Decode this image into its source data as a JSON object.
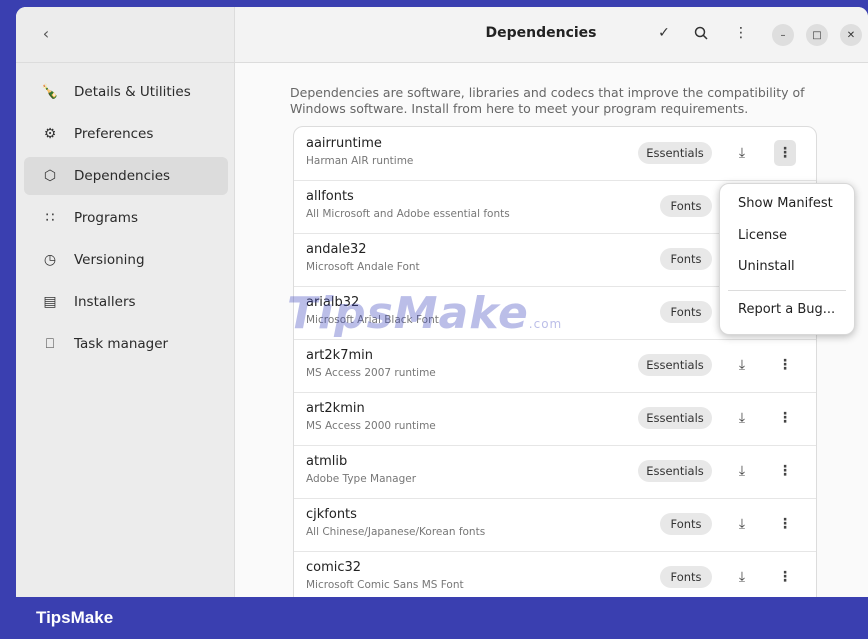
{
  "window": {
    "title": "Dependencies"
  },
  "sidebar": {
    "items": [
      {
        "label": "Details & Utilities",
        "icon": "bottle-icon"
      },
      {
        "label": "Preferences",
        "icon": "gear-icon"
      },
      {
        "label": "Dependencies",
        "icon": "puzzle-icon"
      },
      {
        "label": "Programs",
        "icon": "grid-icon"
      },
      {
        "label": "Versioning",
        "icon": "clock-icon"
      },
      {
        "label": "Installers",
        "icon": "package-icon"
      },
      {
        "label": "Task manager",
        "icon": "monitor-icon"
      }
    ]
  },
  "main": {
    "description": "Dependencies are software, libraries and codecs that improve the compatibility of Windows software. Install from here to meet your program requirements."
  },
  "dependencies": [
    {
      "name": "aairruntime",
      "desc": "Harman AIR runtime",
      "category": "Essentials"
    },
    {
      "name": "allfonts",
      "desc": "All Microsoft and Adobe essential fonts",
      "category": "Fonts"
    },
    {
      "name": "andale32",
      "desc": "Microsoft Andale Font",
      "category": "Fonts"
    },
    {
      "name": "arialb32",
      "desc": "Microsoft Arial Black Font",
      "category": "Fonts"
    },
    {
      "name": "art2k7min",
      "desc": "MS Access 2007 runtime",
      "category": "Essentials"
    },
    {
      "name": "art2kmin",
      "desc": "MS Access 2000 runtime",
      "category": "Essentials"
    },
    {
      "name": "atmlib",
      "desc": "Adobe Type Manager",
      "category": "Essentials"
    },
    {
      "name": "cjkfonts",
      "desc": "All Chinese/Japanese/Korean fonts",
      "category": "Fonts"
    },
    {
      "name": "comic32",
      "desc": "Microsoft Comic Sans MS Font",
      "category": "Fonts"
    }
  ],
  "menu": {
    "items": [
      "Show Manifest",
      "License",
      "Uninstall",
      "Report a Bug..."
    ]
  },
  "watermark": {
    "main": "TipsMake",
    "suffix": ".com"
  },
  "footer": {
    "brand": "TipsMake"
  },
  "colors": {
    "brand": "#3a3fb0",
    "sidebar": "#ececec",
    "active": "#dcdcdc"
  }
}
